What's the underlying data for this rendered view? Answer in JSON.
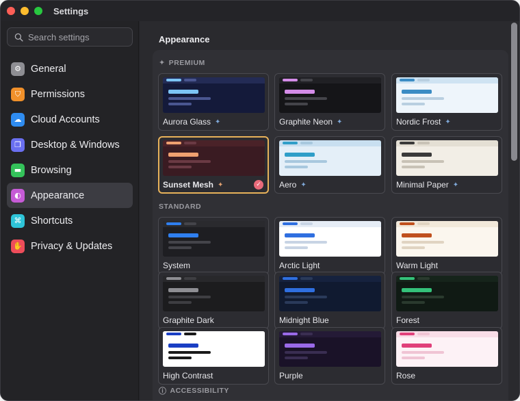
{
  "window": {
    "title": "Settings"
  },
  "search": {
    "placeholder": "Search settings"
  },
  "sidebar": {
    "items": [
      {
        "label": "General",
        "icon": "gear-icon",
        "color": "#8e8e93",
        "glyph": "⚙"
      },
      {
        "label": "Permissions",
        "icon": "shield-icon",
        "color": "#f0902a",
        "glyph": "⛉"
      },
      {
        "label": "Cloud Accounts",
        "icon": "cloud-icon",
        "color": "#2f8cf0",
        "glyph": "☁"
      },
      {
        "label": "Desktop & Windows",
        "icon": "windows-icon",
        "color": "#6a6ff0",
        "glyph": "❐"
      },
      {
        "label": "Browsing",
        "icon": "folder-icon",
        "color": "#34c25a",
        "glyph": "▬"
      },
      {
        "label": "Appearance",
        "icon": "palette-icon",
        "color": "#c65bd6",
        "glyph": "◐"
      },
      {
        "label": "Shortcuts",
        "icon": "command-icon",
        "color": "#2ec4d8",
        "glyph": "⌘"
      },
      {
        "label": "Privacy & Updates",
        "icon": "hand-icon",
        "color": "#ee4d5a",
        "glyph": "✋"
      }
    ],
    "active_index": 5
  },
  "main": {
    "title": "Appearance",
    "groups": [
      {
        "label": "PREMIUM",
        "icon": "sparkle-icon"
      },
      {
        "label": "STANDARD",
        "icon": ""
      },
      {
        "label": "ACCESSIBILITY",
        "icon": "accessibility-icon"
      }
    ],
    "themes": [
      {
        "name": "Aurora Glass",
        "premium": true,
        "selected": false,
        "bg": "#141a3a",
        "accent": "#7cc4f5",
        "line": "#4a5690",
        "bar": "#232b55"
      },
      {
        "name": "Graphite Neon",
        "premium": true,
        "selected": false,
        "bg": "#151518",
        "accent": "#d48ce8",
        "line": "#44444a",
        "bar": "#202024"
      },
      {
        "name": "Nordic Frost",
        "premium": true,
        "selected": false,
        "bg": "#eef5fb",
        "accent": "#3b8cc4",
        "line": "#b9cfe0",
        "bar": "#cfe3f2"
      },
      {
        "name": "Sunset Mesh",
        "premium": true,
        "selected": true,
        "bg": "#3a1b22",
        "accent": "#f0a070",
        "line": "#6a3a44",
        "bar": "#4a2228"
      },
      {
        "name": "Aero",
        "premium": true,
        "selected": false,
        "bg": "#e4eff8",
        "accent": "#2f9ec8",
        "line": "#a8c8de",
        "bar": "#c8dff0"
      },
      {
        "name": "Minimal Paper",
        "premium": true,
        "selected": false,
        "bg": "#f2eee6",
        "accent": "#3a3a3a",
        "line": "#c8c2b6",
        "bar": "#e4dfd4"
      },
      {
        "name": "System",
        "premium": false,
        "selected": false,
        "bg": "#1e1e22",
        "accent": "#2f7ff0",
        "line": "#44444a",
        "bar": "#2a2a2e"
      },
      {
        "name": "Arctic Light",
        "premium": false,
        "selected": false,
        "bg": "#ffffff",
        "accent": "#2f6fe0",
        "line": "#c8d4e4",
        "bar": "#e6edf6"
      },
      {
        "name": "Warm Light",
        "premium": false,
        "selected": false,
        "bg": "#fbf6ee",
        "accent": "#c0501e",
        "line": "#e0d4c2",
        "bar": "#f1e8da"
      },
      {
        "name": "Graphite Dark",
        "premium": false,
        "selected": false,
        "bg": "#1c1c1e",
        "accent": "#8e8e93",
        "line": "#3e3e42",
        "bar": "#28282b"
      },
      {
        "name": "Midnight Blue",
        "premium": false,
        "selected": false,
        "bg": "#101a30",
        "accent": "#2f6fe0",
        "line": "#2a3a5a",
        "bar": "#16223e"
      },
      {
        "name": "Forest",
        "premium": false,
        "selected": false,
        "bg": "#101a14",
        "accent": "#34c27a",
        "line": "#2a3a2e",
        "bar": "#16241b"
      },
      {
        "name": "High Contrast",
        "premium": false,
        "selected": false,
        "bg": "#ffffff",
        "accent": "#1a3fc4",
        "line": "#1a1a1a",
        "bar": "#ffffff"
      },
      {
        "name": "Purple",
        "premium": false,
        "selected": false,
        "bg": "#1a1228",
        "accent": "#9a6ae8",
        "line": "#3a2e52",
        "bar": "#241a36"
      },
      {
        "name": "Rose",
        "premium": false,
        "selected": false,
        "bg": "#fdf2f6",
        "accent": "#e0407a",
        "line": "#f0c4d4",
        "bar": "#f8dde7"
      }
    ]
  }
}
